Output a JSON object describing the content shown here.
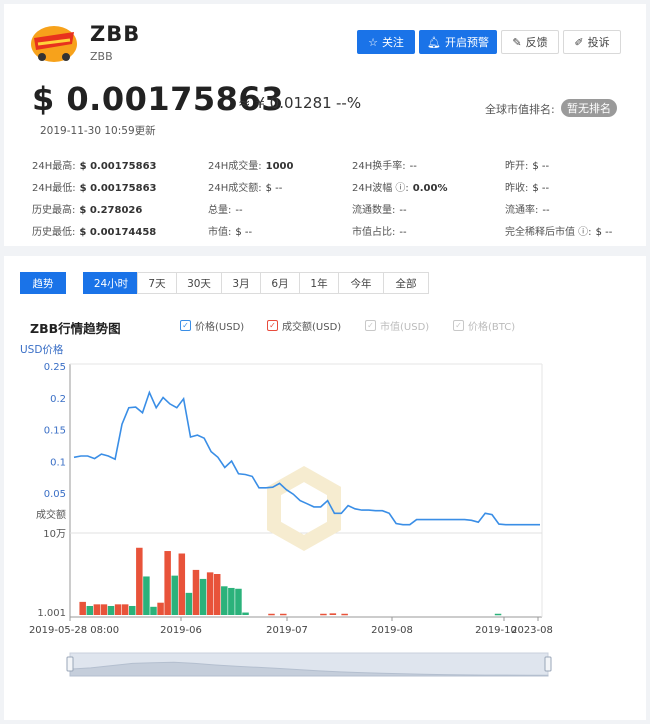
{
  "coin": {
    "name": "ZBB",
    "sub": "ZBB",
    "logo_text": "Dragon Kart"
  },
  "actions": {
    "follow": "关注",
    "alert": "开启预警",
    "feedback": "反馈",
    "complain": "投诉"
  },
  "price": {
    "usd": "$ 0.00175863",
    "cny": "≈ ¥ 0.01281",
    "change": "--%",
    "updated": "2019-11-30 10:59更新"
  },
  "rank": {
    "label": "全球市值排名:",
    "value": "暂无排名"
  },
  "stats": {
    "high24": {
      "label": "24H最高:",
      "value": "$ 0.00175863"
    },
    "low24": {
      "label": "24H最低:",
      "value": "$ 0.00175863"
    },
    "ath": {
      "label": "历史最高:",
      "value": "$ 0.278026"
    },
    "atl": {
      "label": "历史最低:",
      "value": "$ 0.00174458"
    },
    "vol24": {
      "label": "24H成交量:",
      "value": "1000"
    },
    "amount24": {
      "label": "24H成交额:",
      "value": "$ --"
    },
    "supply": {
      "label": "总量:",
      "value": "--"
    },
    "mcap": {
      "label": "市值:",
      "value": "$ --"
    },
    "turnover": {
      "label": "24H换手率:",
      "value": "--"
    },
    "amplitude": {
      "label": "24H波幅 ⓘ:",
      "value": "0.00%"
    },
    "circ": {
      "label": "流通数量:",
      "value": "--"
    },
    "mcap_share": {
      "label": "市值占比:",
      "value": "--"
    },
    "open": {
      "label": "昨开:",
      "value": "$ --"
    },
    "close": {
      "label": "昨收:",
      "value": "$ --"
    },
    "circ_rate": {
      "label": "流通率:",
      "value": "--"
    },
    "fdv": {
      "label": "完全稀释后市值 ⓘ:",
      "value": "$ --"
    }
  },
  "tabs": {
    "trend": "趋势",
    "ranges": [
      "24小时",
      "7天",
      "30天",
      "3月",
      "6月",
      "1年",
      "今年",
      "全部"
    ],
    "active_range": "24小时"
  },
  "chart_title": "ZBB行情趋势图",
  "legend": {
    "price": {
      "label": "价格(USD)",
      "color": "#3a8ee6",
      "checked": true
    },
    "amount": {
      "label": "成交额(USD)",
      "color": "#e84c3d",
      "checked": true
    },
    "mcap": {
      "label": "市值(USD)",
      "color": "#c8c8c8",
      "checked": false
    },
    "btc": {
      "label": "价格(BTC)",
      "color": "#c8c8c8",
      "checked": false
    }
  },
  "chart_data": {
    "type": "line",
    "ylabel": "USD价格",
    "y_ticks": [
      "0.25",
      "0.2",
      "0.15",
      "0.1",
      "0.05"
    ],
    "ylim": [
      0,
      0.25
    ],
    "x_ticks": [
      "2019-05-28 08:00",
      "2019-06",
      "2019-07",
      "2019-08",
      "2019-10",
      "2023-08"
    ],
    "grid": false,
    "price_series": {
      "name": "价格(USD)",
      "values": [
        0.108,
        0.11,
        0.11,
        0.106,
        0.113,
        0.11,
        0.105,
        0.16,
        0.186,
        0.187,
        0.178,
        0.21,
        0.186,
        0.202,
        0.192,
        0.186,
        0.2,
        0.14,
        0.143,
        0.138,
        0.117,
        0.108,
        0.092,
        0.102,
        0.082,
        0.081,
        0.078,
        0.06,
        0.06,
        0.061,
        0.067,
        0.057,
        0.05,
        0.04,
        0.035,
        0.03,
        0.03,
        0.04,
        0.02,
        0.02,
        0.032,
        0.027,
        0.025,
        0.025,
        0.024,
        0.024,
        0.02,
        0.004,
        0.002,
        0.002,
        0.01,
        0.01,
        0.01,
        0.01,
        0.01,
        0.01,
        0.01,
        0.01,
        0.009,
        0.006,
        0.02,
        0.018,
        0.003,
        0.002,
        0.002,
        0.002,
        0.002,
        0.002,
        0.002
      ]
    },
    "volume_axis": {
      "label": "成交额",
      "top_tick": "10万",
      "bottom_tick": "1.001"
    },
    "volume_series": {
      "name": "成交额(USD)",
      "bars": [
        {
          "x": 0.02,
          "v": 0.16,
          "c": "red"
        },
        {
          "x": 0.035,
          "v": 0.11,
          "c": "green"
        },
        {
          "x": 0.05,
          "v": 0.13,
          "c": "red"
        },
        {
          "x": 0.065,
          "v": 0.13,
          "c": "red"
        },
        {
          "x": 0.08,
          "v": 0.11,
          "c": "green"
        },
        {
          "x": 0.095,
          "v": 0.13,
          "c": "red"
        },
        {
          "x": 0.11,
          "v": 0.13,
          "c": "red"
        },
        {
          "x": 0.125,
          "v": 0.11,
          "c": "green"
        },
        {
          "x": 0.14,
          "v": 0.82,
          "c": "red"
        },
        {
          "x": 0.155,
          "v": 0.47,
          "c": "green"
        },
        {
          "x": 0.17,
          "v": 0.1,
          "c": "green"
        },
        {
          "x": 0.185,
          "v": 0.15,
          "c": "red"
        },
        {
          "x": 0.2,
          "v": 0.78,
          "c": "red"
        },
        {
          "x": 0.215,
          "v": 0.48,
          "c": "green"
        },
        {
          "x": 0.23,
          "v": 0.75,
          "c": "red"
        },
        {
          "x": 0.245,
          "v": 0.27,
          "c": "green"
        },
        {
          "x": 0.26,
          "v": 0.55,
          "c": "red"
        },
        {
          "x": 0.275,
          "v": 0.44,
          "c": "green"
        },
        {
          "x": 0.29,
          "v": 0.52,
          "c": "red"
        },
        {
          "x": 0.305,
          "v": 0.5,
          "c": "red"
        },
        {
          "x": 0.32,
          "v": 0.35,
          "c": "green"
        },
        {
          "x": 0.335,
          "v": 0.33,
          "c": "green"
        },
        {
          "x": 0.35,
          "v": 0.32,
          "c": "green"
        },
        {
          "x": 0.365,
          "v": 0.03,
          "c": "green"
        },
        {
          "x": 0.42,
          "v": 0.015,
          "c": "red"
        },
        {
          "x": 0.445,
          "v": 0.015,
          "c": "red"
        },
        {
          "x": 0.53,
          "v": 0.015,
          "c": "red"
        },
        {
          "x": 0.55,
          "v": 0.02,
          "c": "red"
        },
        {
          "x": 0.575,
          "v": 0.015,
          "c": "red"
        },
        {
          "x": 0.9,
          "v": 0.015,
          "c": "green"
        }
      ]
    },
    "navigator_series": [
      0.3,
      0.35,
      0.45,
      0.55,
      0.58,
      0.6,
      0.55,
      0.48,
      0.42,
      0.38,
      0.33,
      0.28,
      0.22,
      0.18,
      0.15,
      0.12,
      0.1,
      0.08,
      0.06,
      0.05,
      0.04,
      0.04,
      0.03,
      0.03
    ]
  }
}
